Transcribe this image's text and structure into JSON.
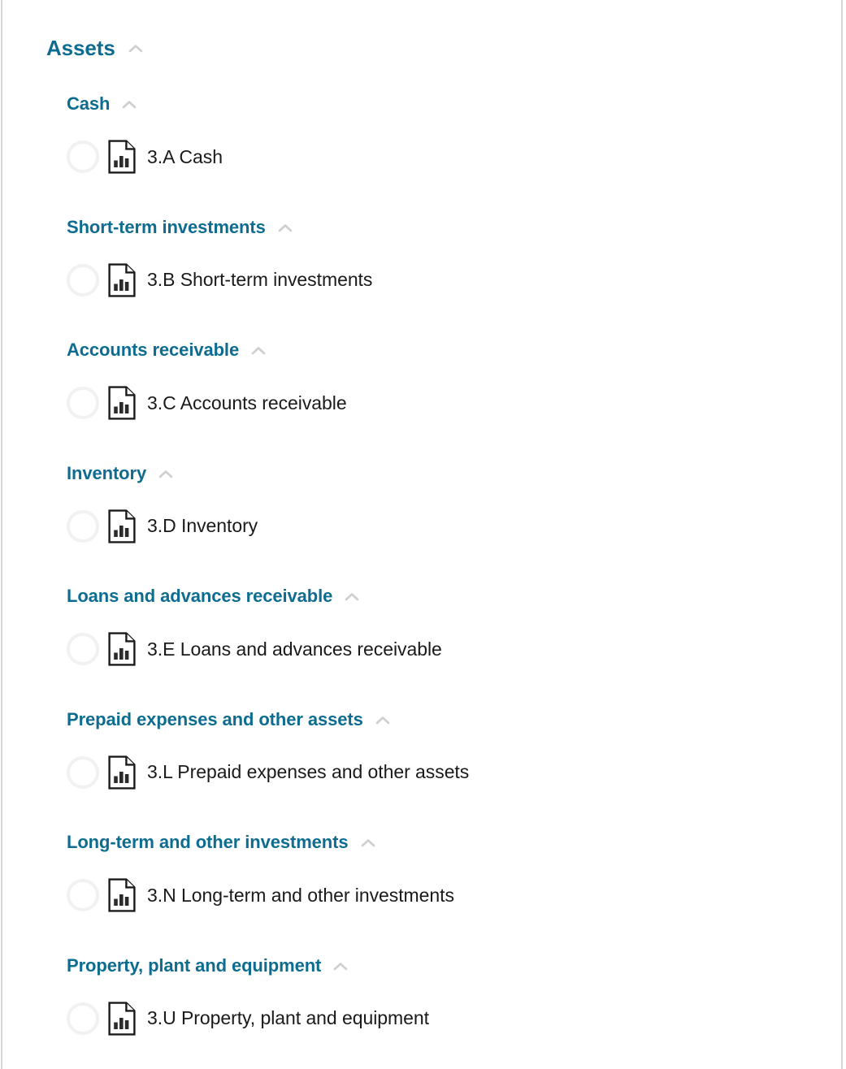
{
  "panel": {
    "background_color": "#ffffff",
    "border_color": "#d6d6d6",
    "header_color": "#0e6c90",
    "label_color": "#1a1a1a",
    "chevron_color": "#cfcfcf",
    "radio_color": "#f1f1f1"
  },
  "group": {
    "label": "Assets",
    "chevron_icon": "chevron-up-icon",
    "expanded": true
  },
  "sections": [
    {
      "label": "Cash",
      "chevron_icon": "chevron-up-icon",
      "expanded": true,
      "item": {
        "label": "3.A Cash",
        "icon": "document-bar-chart-icon",
        "selector_icon": "radio-unchecked-icon",
        "selected": false
      }
    },
    {
      "label": "Short-term investments",
      "chevron_icon": "chevron-up-icon",
      "expanded": true,
      "item": {
        "label": "3.B Short-term investments",
        "icon": "document-bar-chart-icon",
        "selector_icon": "radio-unchecked-icon",
        "selected": false
      }
    },
    {
      "label": "Accounts receivable",
      "chevron_icon": "chevron-up-icon",
      "expanded": true,
      "item": {
        "label": "3.C Accounts receivable",
        "icon": "document-bar-chart-icon",
        "selector_icon": "radio-unchecked-icon",
        "selected": false
      }
    },
    {
      "label": "Inventory",
      "chevron_icon": "chevron-up-icon",
      "expanded": true,
      "item": {
        "label": "3.D Inventory",
        "icon": "document-bar-chart-icon",
        "selector_icon": "radio-unchecked-icon",
        "selected": false
      }
    },
    {
      "label": "Loans and advances receivable",
      "chevron_icon": "chevron-up-icon",
      "expanded": true,
      "item": {
        "label": "3.E Loans and advances receivable",
        "icon": "document-bar-chart-icon",
        "selector_icon": "radio-unchecked-icon",
        "selected": false
      }
    },
    {
      "label": "Prepaid expenses and other assets",
      "chevron_icon": "chevron-up-icon",
      "expanded": true,
      "item": {
        "label": "3.L Prepaid expenses and other assets",
        "icon": "document-bar-chart-icon",
        "selector_icon": "radio-unchecked-icon",
        "selected": false
      }
    },
    {
      "label": "Long-term and other investments",
      "chevron_icon": "chevron-up-icon",
      "expanded": true,
      "item": {
        "label": "3.N Long-term and other investments",
        "icon": "document-bar-chart-icon",
        "selector_icon": "radio-unchecked-icon",
        "selected": false
      }
    },
    {
      "label": "Property, plant and equipment",
      "chevron_icon": "chevron-up-icon",
      "expanded": true,
      "item": {
        "label": "3.U Property, plant and equipment",
        "icon": "document-bar-chart-icon",
        "selector_icon": "radio-unchecked-icon",
        "selected": false
      }
    }
  ]
}
